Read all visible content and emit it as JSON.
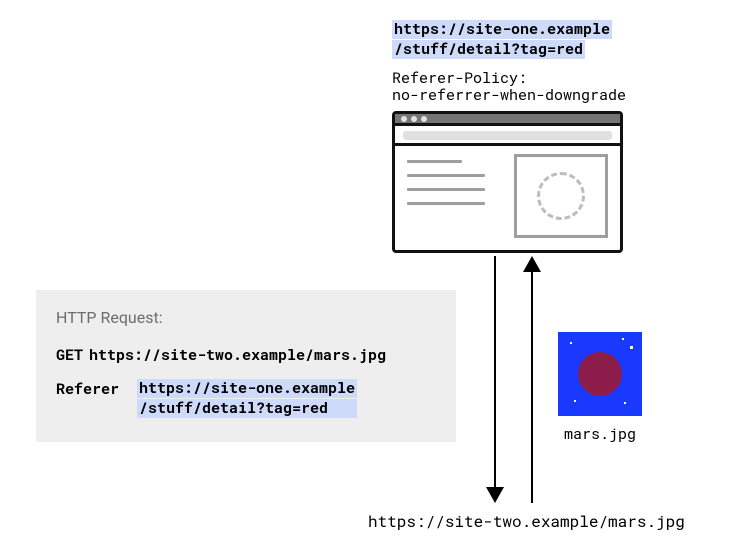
{
  "topUrl": {
    "line1": "https://site-one.example",
    "line2": "/stuff/detail?tag=red"
  },
  "policy": {
    "label": "Referer-Policy:",
    "value": "no-referrer-when-downgrade"
  },
  "request": {
    "title": "HTTP Request:",
    "method": "GET",
    "url": "https://site-two.example/mars.jpg",
    "refererLabel": "Referer",
    "refererLine1": "https://site-one.example",
    "refererLine2": "/stuff/detail?tag=red"
  },
  "mars": {
    "filename": "mars.jpg"
  },
  "bottomUrl": "https://site-two.example/mars.jpg"
}
